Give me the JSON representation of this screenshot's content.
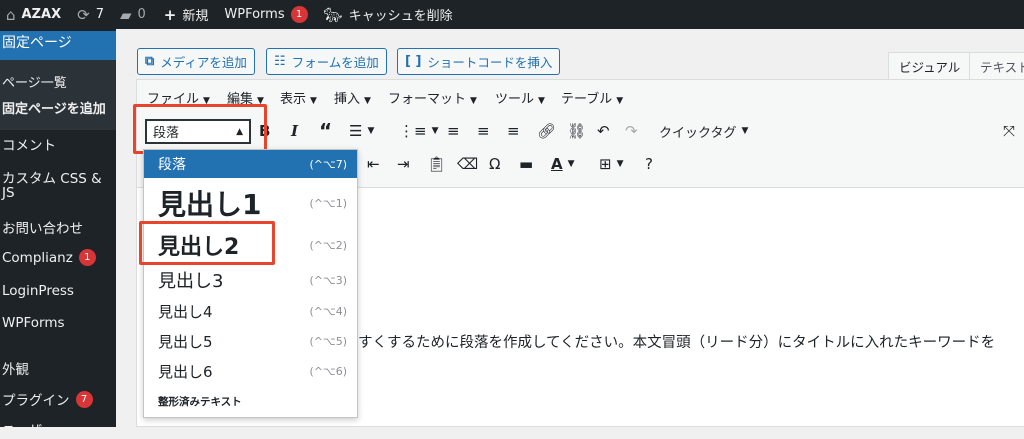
{
  "adminbar": {
    "site_name": "AZAX",
    "updates_count": "7",
    "comments_count": "0",
    "new_label": "新規",
    "wpforms_label": "WPForms",
    "wpforms_badge": "1",
    "cache_label": "キャッシュを削除"
  },
  "sidebar": {
    "current": "固定ページ",
    "sub_items": [
      "ページ一覧",
      "固定ページを追加"
    ],
    "items": [
      {
        "label": "コメント"
      },
      {
        "label": "カスタム CSS &"
      },
      {
        "label": "JS"
      },
      {
        "label": "お問い合わせ"
      },
      {
        "label": "Complianz",
        "badge": "1"
      },
      {
        "label": "LoginPress"
      },
      {
        "label": "WPForms"
      },
      {
        "label": "外観"
      },
      {
        "label": "プラグイン",
        "badge": "7"
      },
      {
        "label": "ユーザー"
      }
    ]
  },
  "media_buttons": {
    "add_media": "メディアを追加",
    "add_form": "フォームを追加",
    "insert_shortcode": "ショートコードを挿入"
  },
  "tabs": {
    "visual": "ビジュアル",
    "text": "テキスト"
  },
  "menubar": [
    "ファイル",
    "編集",
    "表示",
    "挿入",
    "フォーマット",
    "ツール",
    "テーブル"
  ],
  "format_select": {
    "value": "段落"
  },
  "toolbar": {
    "quick_tag": "クイックタグ"
  },
  "dropdown": {
    "items": [
      {
        "label": "段落",
        "shortcut": "(^⌥7)"
      },
      {
        "label": "見出し1",
        "shortcut": "(^⌥1)"
      },
      {
        "label": "見出し2",
        "shortcut": "(^⌥2)"
      },
      {
        "label": "見出し3",
        "shortcut": "(^⌥3)"
      },
      {
        "label": "見出し4",
        "shortcut": "(^⌥4)"
      },
      {
        "label": "見出し5",
        "shortcut": "(^⌥5)"
      },
      {
        "label": "見出し6",
        "shortcut": "(^⌥6)"
      },
      {
        "label": "整形済みテキスト",
        "shortcut": ""
      }
    ]
  },
  "content": {
    "text": "すくするために段落を作成してください。本文冒頭（リード分）にタイトルに入れたキーワードを"
  },
  "colors": {
    "admin_bar": "#1d2327",
    "accent": "#2271b1",
    "highlight": "#e8452c",
    "badge": "#d63638"
  }
}
